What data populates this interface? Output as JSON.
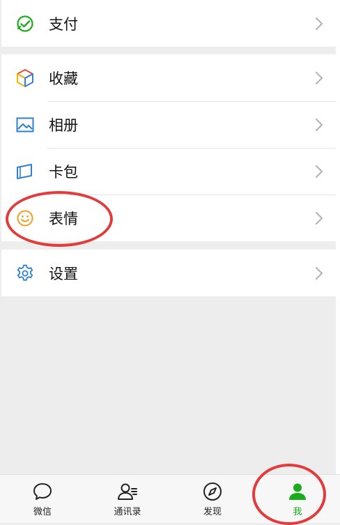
{
  "colors": {
    "accent_green": "#1aad19",
    "annotation_red": "#e23b3b",
    "pay_icon_green": "#1aad19",
    "collect_icon_yellow": "#f4b400",
    "collect_icon_red": "#e84b3c",
    "collect_icon_blue": "#3a7fd5",
    "album_icon_blue": "#2c7fd1",
    "card_icon_blue": "#2c7fd1",
    "sticker_icon_orange": "#f0a020",
    "settings_icon_blue": "#2c7fd1"
  },
  "menu": {
    "pay": {
      "label": "支付",
      "icon": "wechat-pay-icon"
    },
    "favorites": {
      "label": "收藏",
      "icon": "cube-icon"
    },
    "album": {
      "label": "相册",
      "icon": "image-icon"
    },
    "cards": {
      "label": "卡包",
      "icon": "card-wallet-icon"
    },
    "stickers": {
      "label": "表情",
      "icon": "smiley-icon"
    },
    "settings": {
      "label": "设置",
      "icon": "gear-icon"
    }
  },
  "tabbar": {
    "chats": {
      "label": "微信",
      "icon": "chat-bubble-icon"
    },
    "contacts": {
      "label": "通讯录",
      "icon": "contacts-icon"
    },
    "discover": {
      "label": "发现",
      "icon": "compass-icon"
    },
    "me": {
      "label": "我",
      "icon": "person-icon",
      "active": true
    }
  }
}
